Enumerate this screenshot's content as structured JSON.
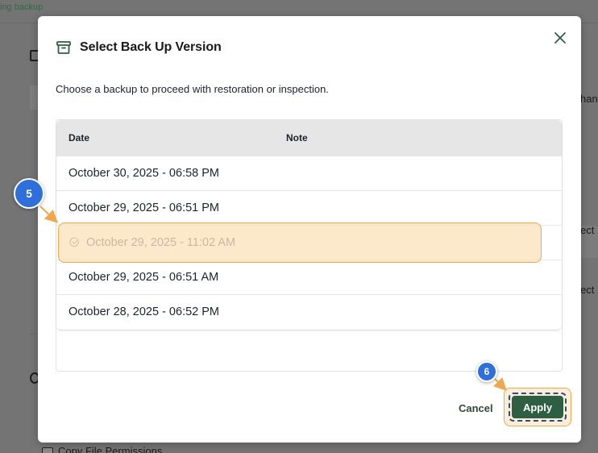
{
  "background": {
    "breadcrumb": "ing backup",
    "right_fragments": [
      "han",
      "ect",
      "ect"
    ],
    "bottom_text": "Copy File Permissions"
  },
  "dialog": {
    "title": "Select Back Up Version",
    "title_icon": "archive-icon",
    "close_icon": "close-icon",
    "description": "Choose a backup to proceed with restoration or inspection.",
    "columns": [
      "Date",
      "Note"
    ],
    "rows": [
      {
        "date": "October 30, 2025 - 06:58 PM",
        "note": "",
        "selected": false
      },
      {
        "date": "October 29, 2025 - 06:51 PM",
        "note": "",
        "selected": false
      },
      {
        "date": "October 29, 2025 - 11:02 AM",
        "note": "",
        "selected": true
      },
      {
        "date": "October 29, 2025 - 06:51 AM",
        "note": "",
        "selected": false
      },
      {
        "date": "October 28, 2025 - 06:52 PM",
        "note": "",
        "selected": false
      }
    ],
    "cancel_label": "Cancel",
    "apply_label": "Apply"
  },
  "annotations": {
    "step_select_row": "5",
    "step_apply": "6"
  },
  "colors": {
    "accent_green": "#2f5f43",
    "highlight_orange": "#f0a850",
    "marker_blue": "#2f6fdb"
  }
}
